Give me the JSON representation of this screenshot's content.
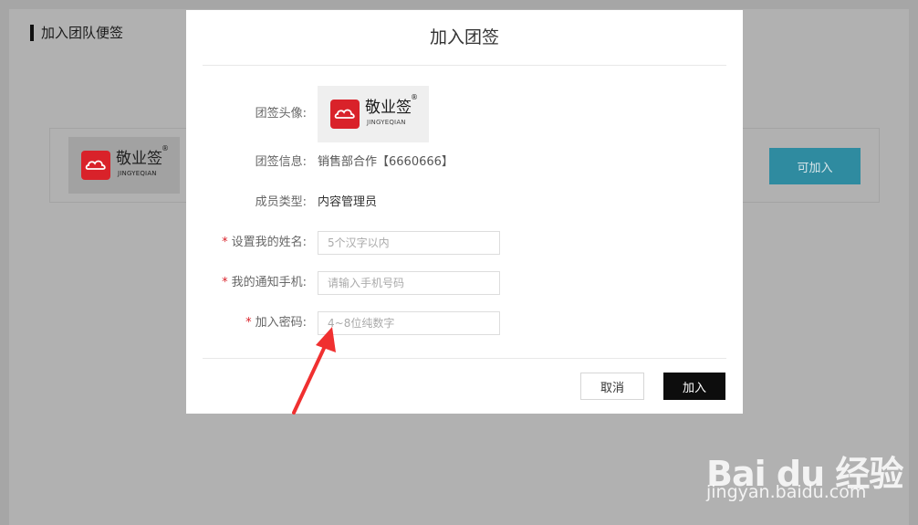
{
  "page": {
    "title": "加入团队便签",
    "join_button": "可加入"
  },
  "logo": {
    "icon": "cloud-shoe-icon",
    "brand_cn": "敬业签",
    "brand_en": "JINGYEQIAN",
    "registered": "®",
    "brand_color": "#d9222a"
  },
  "modal": {
    "title": "加入团签",
    "avatar_label": "团签头像:",
    "info_label": "团签信息:",
    "info_value": "销售部合作【6660666】",
    "member_type_label": "成员类型:",
    "member_type_value": "内容管理员",
    "required_mark": "*",
    "name_label": "设置我的姓名:",
    "name_placeholder": "5个汉字以内",
    "phone_label": "我的通知手机:",
    "phone_placeholder": "请输入手机号码",
    "password_label": "加入密码:",
    "password_placeholder": "4~8位纯数字",
    "cancel_button": "取消",
    "join_button": "加入"
  },
  "watermark": {
    "main": "Bai du 经验",
    "sub": "jingyan.baidu.com"
  },
  "colors": {
    "accent_button": "#2f8ba0",
    "primary_button": "#0d0d0d",
    "required": "#d9222a",
    "annotation_arrow": "#f03030"
  }
}
